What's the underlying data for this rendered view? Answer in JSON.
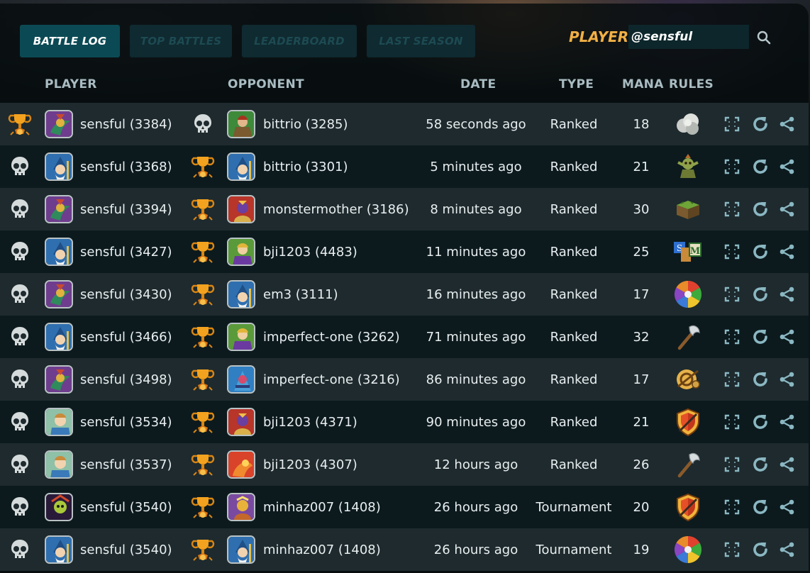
{
  "tabs": [
    {
      "label": "BATTLE LOG",
      "active": true
    },
    {
      "label": "TOP BATTLES",
      "active": false
    },
    {
      "label": "LEADERBOARD",
      "active": false
    },
    {
      "label": "LAST SEASON",
      "active": false
    }
  ],
  "player_filter": {
    "label": "PLAYER:",
    "value": "@sensful",
    "search_icon": "search-icon"
  },
  "columns": [
    "PLAYER",
    "OPPONENT",
    "DATE",
    "TYPE",
    "MANA",
    "RULES"
  ],
  "battles": [
    {
      "result": "win",
      "player": "sensful (3384)",
      "player_avatar": "dragon",
      "opponent": "bittrio (3285)",
      "opponent_avatar": "jungle",
      "date": "58 seconds ago",
      "type": "Ranked",
      "mana": "18",
      "rule_icon": "dust-cloud-icon"
    },
    {
      "result": "loss",
      "player": "sensful (3368)",
      "player_avatar": "wizard",
      "opponent": "bittrio (3301)",
      "opponent_avatar": "wizard",
      "date": "5 minutes ago",
      "type": "Ranked",
      "mana": "21",
      "rule_icon": "goblin-icon"
    },
    {
      "result": "loss",
      "player": "sensful (3394)",
      "player_avatar": "dragon",
      "opponent": "monstermother (3186)",
      "opponent_avatar": "fire",
      "date": "8 minutes ago",
      "type": "Ranked",
      "mana": "30",
      "rule_icon": "land-icon"
    },
    {
      "result": "loss",
      "player": "sensful (3427)",
      "player_avatar": "wizard",
      "opponent": "bji1203 (4483)",
      "opponent_avatar": "forest",
      "date": "11 minutes ago",
      "type": "Ranked",
      "mana": "25",
      "rule_icon": "sm-blocks-icon"
    },
    {
      "result": "loss",
      "player": "sensful (3430)",
      "player_avatar": "dragon",
      "opponent": "em3 (3111)",
      "opponent_avatar": "wizard",
      "date": "16 minutes ago",
      "type": "Ranked",
      "mana": "17",
      "rule_icon": "color-wheel-icon"
    },
    {
      "result": "loss",
      "player": "sensful (3466)",
      "player_avatar": "wizard",
      "opponent": "imperfect-one (3262)",
      "opponent_avatar": "forest",
      "date": "71 minutes ago",
      "type": "Ranked",
      "mana": "32",
      "rule_icon": "axe-icon"
    },
    {
      "result": "loss",
      "player": "sensful (3498)",
      "player_avatar": "dragon",
      "opponent": "imperfect-one (3216)",
      "opponent_avatar": "water",
      "date": "86 minutes ago",
      "type": "Ranked",
      "mana": "17",
      "rule_icon": "net-icon"
    },
    {
      "result": "loss",
      "player": "sensful (3534)",
      "player_avatar": "knight",
      "opponent": "bji1203 (4371)",
      "opponent_avatar": "fire",
      "date": "90 minutes ago",
      "type": "Ranked",
      "mana": "21",
      "rule_icon": "shield-icon"
    },
    {
      "result": "loss",
      "player": "sensful (3537)",
      "player_avatar": "knight",
      "opponent": "bji1203 (4307)",
      "opponent_avatar": "red",
      "date": "12 hours ago",
      "type": "Ranked",
      "mana": "26",
      "rule_icon": "axe-icon"
    },
    {
      "result": "loss",
      "player": "sensful (3540)",
      "player_avatar": "death",
      "opponent": "minhaz007 (1408)",
      "opponent_avatar": "gold",
      "date": "26 hours ago",
      "type": "Tournament",
      "mana": "20",
      "rule_icon": "shield-icon"
    },
    {
      "result": "loss",
      "player": "sensful (3540)",
      "player_avatar": "wizard",
      "opponent": "minhaz007 (1408)",
      "opponent_avatar": "wizard",
      "date": "26 hours ago",
      "type": "Tournament",
      "mana": "19",
      "rule_icon": "color-wheel-icon"
    }
  ],
  "row_actions": [
    "expand-icon",
    "replay-icon",
    "share-icon"
  ],
  "colors": {
    "accent": "#0b4a55",
    "gold": "#f1b045",
    "row_odd": "#1e2a2e",
    "row_even": "#0c1a1e"
  }
}
